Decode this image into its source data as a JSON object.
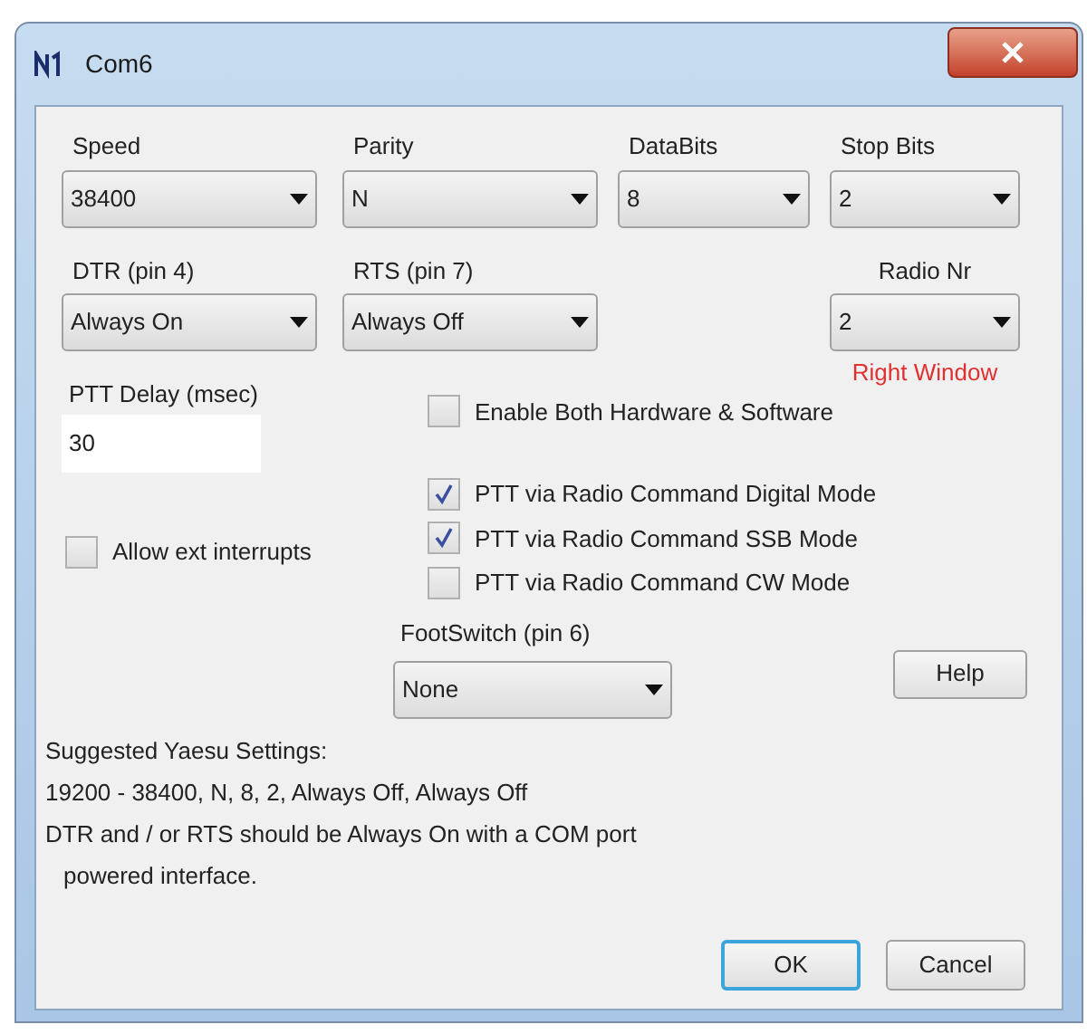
{
  "window": {
    "title": "Com6"
  },
  "row1": [
    {
      "label": "Speed",
      "value": "38400"
    },
    {
      "label": "Parity",
      "value": "N"
    },
    {
      "label": "DataBits",
      "value": "8"
    },
    {
      "label": "Stop Bits",
      "value": "2"
    }
  ],
  "row2": [
    {
      "label": "DTR (pin 4)",
      "value": "Always On"
    },
    {
      "label": "RTS (pin 7)",
      "value": "Always Off"
    },
    {
      "label": "Radio Nr",
      "value": "2"
    }
  ],
  "radio_note": "Right Window",
  "ptt_delay": {
    "label": "PTT Delay  (msec)",
    "value": "30"
  },
  "enable_both": {
    "label": "Enable Both Hardware & Software",
    "checked": false
  },
  "allow_ext": {
    "label": "Allow ext interrupts",
    "checked": false
  },
  "ptt_options": [
    {
      "label": "PTT via Radio Command Digital Mode",
      "checked": true
    },
    {
      "label": "PTT via Radio Command SSB Mode",
      "checked": true
    },
    {
      "label": "PTT via Radio Command CW Mode",
      "checked": false
    }
  ],
  "footswitch": {
    "label": "FootSwitch (pin 6)",
    "value": "None"
  },
  "help_button": "Help",
  "notes": [
    "Suggested Yaesu Settings:",
    "19200 - 38400, N, 8, 2, Always Off, Always Off",
    "DTR and / or RTS should be Always On with a COM port",
    "powered interface."
  ],
  "buttons": [
    {
      "label": "OK",
      "default": true
    },
    {
      "label": "Cancel",
      "default": false
    }
  ]
}
